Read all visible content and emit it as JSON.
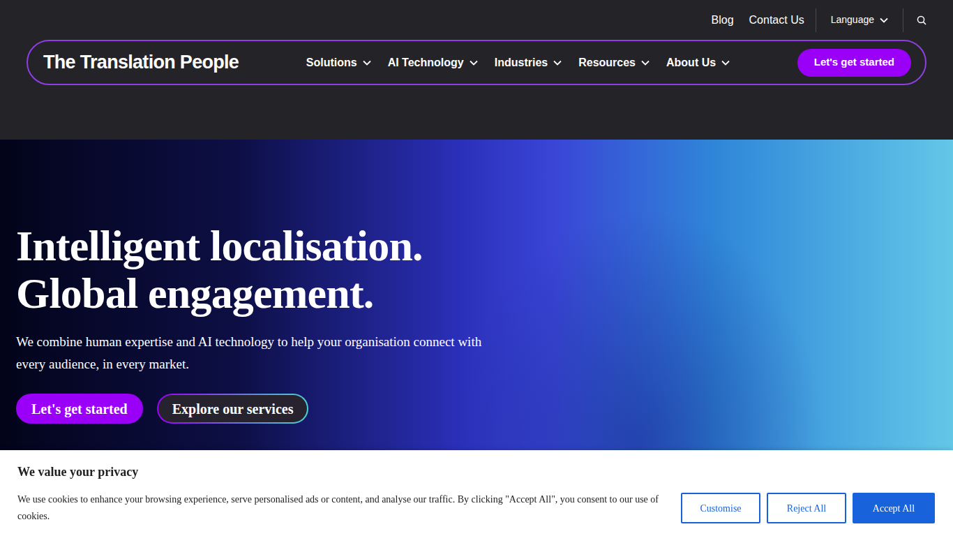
{
  "top_bar": {
    "links": [
      "Blog",
      "Contact Us"
    ],
    "language": "Language"
  },
  "nav": {
    "logo": "The Translation People",
    "items": [
      "Solutions",
      "AI Technology",
      "Industries",
      "Resources",
      "About Us"
    ],
    "cta": "Let's get started"
  },
  "hero": {
    "title_lines": [
      "Intelligent localisation.",
      "Global engagement."
    ],
    "text": "We combine human expertise and AI technology to help your organisation connect with every audience, in every market.",
    "buttons": [
      "Let's get started",
      "Explore our services"
    ]
  },
  "cookie_banner": {
    "title": "We value your privacy",
    "text": "We use cookies to enhance your browsing experience, serve personalised ads or content, and analyse our traffic. By clicking \"Accept All\", you consent to our use of cookies.",
    "buttons": [
      "Customise",
      "Reject All",
      "Accept All"
    ]
  }
}
